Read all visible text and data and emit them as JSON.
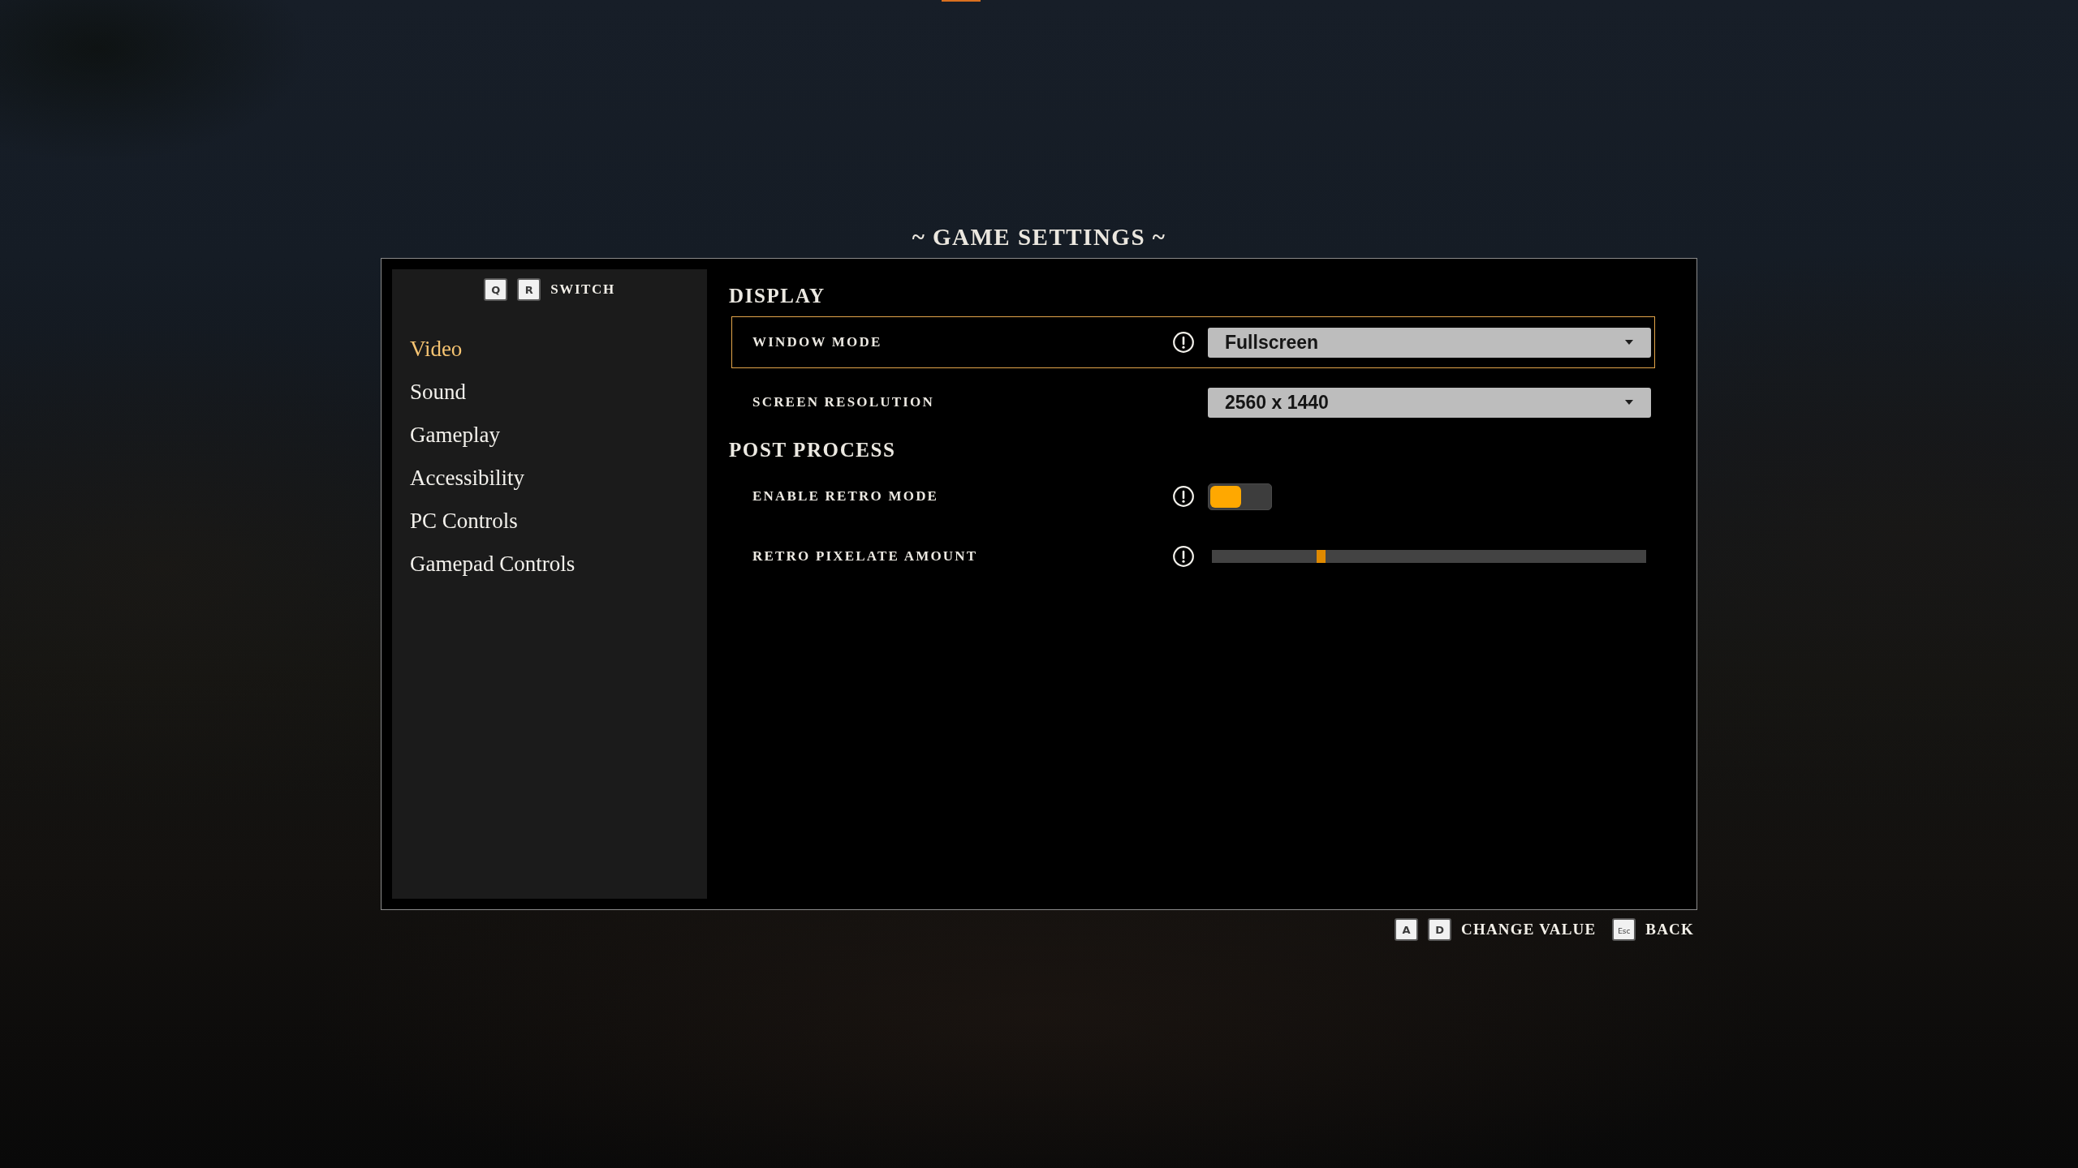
{
  "title": "~ GAME SETTINGS ~",
  "sidebar": {
    "hint": {
      "keys": [
        "Q",
        "R"
      ],
      "label": "SWITCH"
    },
    "items": [
      {
        "label": "Video",
        "selected": true
      },
      {
        "label": "Sound",
        "selected": false
      },
      {
        "label": "Gameplay",
        "selected": false
      },
      {
        "label": "Accessibility",
        "selected": false
      },
      {
        "label": "PC Controls",
        "selected": false
      },
      {
        "label": "Gamepad Controls",
        "selected": false
      }
    ]
  },
  "content": {
    "sections": [
      {
        "heading": "DISPLAY",
        "settings": [
          {
            "kind": "dropdown",
            "label": "WINDOW MODE",
            "info": true,
            "selected": true,
            "value": "Fullscreen"
          },
          {
            "kind": "dropdown",
            "label": "SCREEN RESOLUTION",
            "info": false,
            "selected": false,
            "value": "2560 x 1440"
          }
        ]
      },
      {
        "heading": "POST PROCESS",
        "settings": [
          {
            "kind": "toggle",
            "label": "ENABLE RETRO MODE",
            "info": true,
            "selected": false,
            "on": false
          },
          {
            "kind": "slider",
            "label": "RETRO PIXELATE AMOUNT",
            "info": true,
            "selected": false,
            "level": 0.25
          }
        ]
      }
    ]
  },
  "footer_hints": [
    {
      "keys": [
        "A",
        "D"
      ],
      "label": "CHANGE VALUE"
    },
    {
      "keys": [
        "Esc"
      ],
      "label": "BACK"
    }
  ]
}
